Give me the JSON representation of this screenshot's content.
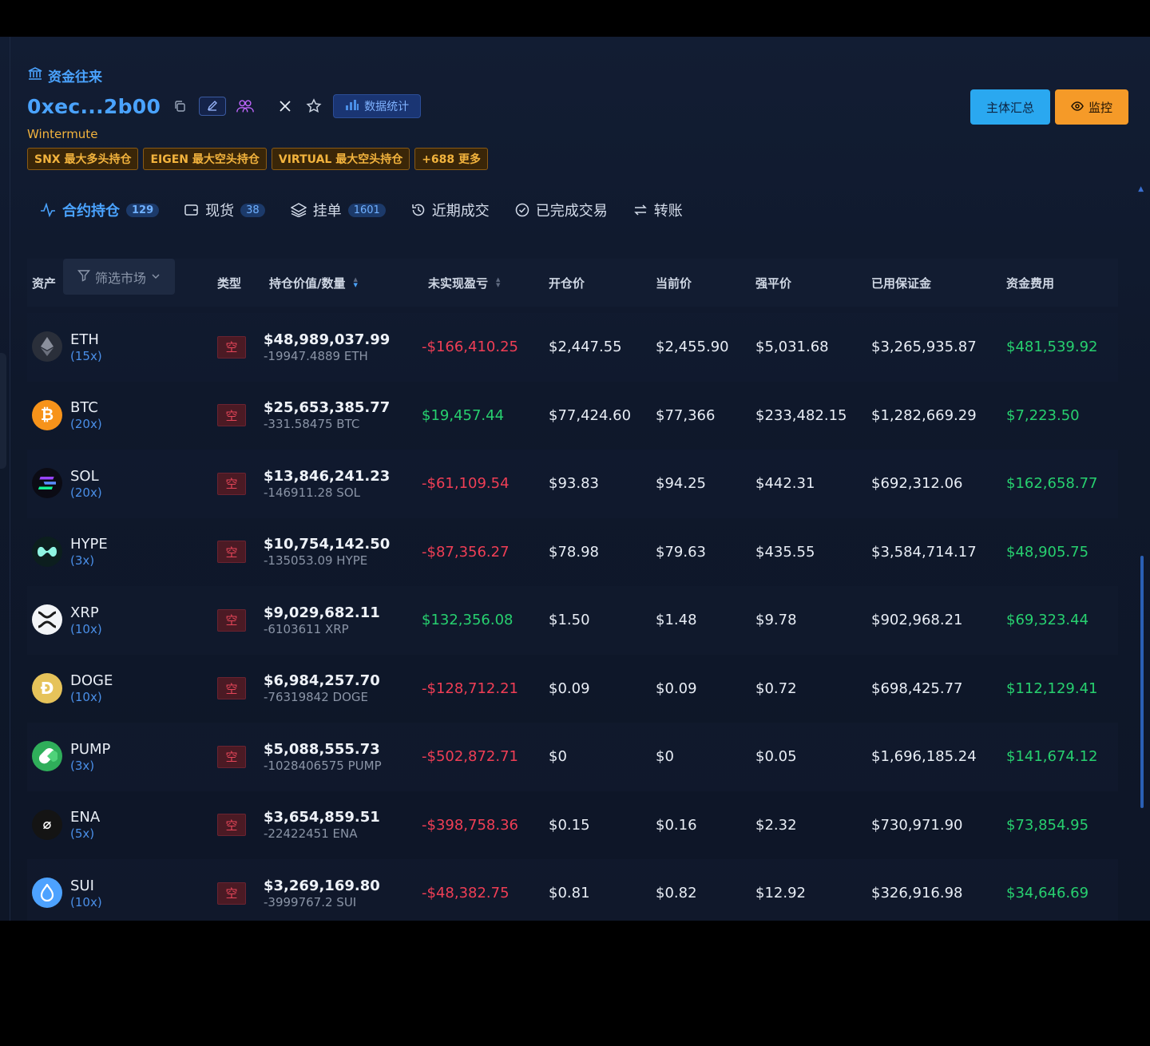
{
  "header": {
    "section_title": "资金往来",
    "address": "0xec...2b00",
    "stats_label": "数据统计",
    "entity": "Wintermute",
    "tags": [
      "SNX 最大多头持仓",
      "EIGEN 最大空头持仓",
      "VIRTUAL 最大空头持仓",
      "+688 更多"
    ],
    "summary_button": "主体汇总",
    "monitor_button": "监控"
  },
  "tabs": [
    {
      "label": "合约持仓",
      "count": "129",
      "icon": "pulse-icon"
    },
    {
      "label": "现货",
      "count": "38",
      "icon": "wallet-icon"
    },
    {
      "label": "挂单",
      "count": "1601",
      "icon": "layers-icon"
    },
    {
      "label": "近期成交",
      "icon": "history-icon"
    },
    {
      "label": "已完成交易",
      "icon": "check-circle-icon"
    },
    {
      "label": "转账",
      "icon": "transfer-icon"
    }
  ],
  "table": {
    "headers": {
      "asset": "资产",
      "filter": "筛选市场",
      "type": "类型",
      "position": "持仓价值/数量",
      "pnl": "未实现盈亏",
      "open": "开仓价",
      "current": "当前价",
      "liq": "强平价",
      "margin": "已用保证金",
      "funding": "资金费用"
    },
    "rows": [
      {
        "symbol": "ETH",
        "leverage": "(15x)",
        "type": "空",
        "value": "$48,989,037.99",
        "qty": "-19947.4889 ETH",
        "pnl": "-$166,410.25",
        "pnl_sign": "neg",
        "open": "$2,447.55",
        "current": "$2,455.90",
        "liq": "$5,031.68",
        "margin": "$3,265,935.87",
        "funding": "$481,539.92",
        "icon": "eth-icon",
        "color": "#2a2f3a"
      },
      {
        "symbol": "BTC",
        "leverage": "(20x)",
        "type": "空",
        "value": "$25,653,385.77",
        "qty": "-331.58475 BTC",
        "pnl": "$19,457.44",
        "pnl_sign": "pos",
        "open": "$77,424.60",
        "current": "$77,366",
        "liq": "$233,482.15",
        "margin": "$1,282,669.29",
        "funding": "$7,223.50",
        "icon": "btc-icon",
        "color": "#f7931a"
      },
      {
        "symbol": "SOL",
        "leverage": "(20x)",
        "type": "空",
        "value": "$13,846,241.23",
        "qty": "-146911.28 SOL",
        "pnl": "-$61,109.54",
        "pnl_sign": "neg",
        "open": "$93.83",
        "current": "$94.25",
        "liq": "$442.31",
        "margin": "$692,312.06",
        "funding": "$162,658.77",
        "icon": "sol-icon",
        "color": "#0b0b14"
      },
      {
        "symbol": "HYPE",
        "leverage": "(3x)",
        "type": "空",
        "value": "$10,754,142.50",
        "qty": "-135053.09 HYPE",
        "pnl": "-$87,356.27",
        "pnl_sign": "neg",
        "open": "$78.98",
        "current": "$79.63",
        "liq": "$435.55",
        "margin": "$3,584,714.17",
        "funding": "$48,905.75",
        "icon": "hype-icon",
        "color": "#0c1e1e"
      },
      {
        "symbol": "XRP",
        "leverage": "(10x)",
        "type": "空",
        "value": "$9,029,682.11",
        "qty": "-6103611 XRP",
        "pnl": "$132,356.08",
        "pnl_sign": "pos",
        "open": "$1.50",
        "current": "$1.48",
        "liq": "$9.78",
        "margin": "$902,968.21",
        "funding": "$69,323.44",
        "icon": "xrp-icon",
        "color": "#f2f4f7"
      },
      {
        "symbol": "DOGE",
        "leverage": "(10x)",
        "type": "空",
        "value": "$6,984,257.70",
        "qty": "-76319842 DOGE",
        "pnl": "-$128,712.21",
        "pnl_sign": "neg",
        "open": "$0.09",
        "current": "$0.09",
        "liq": "$0.72",
        "margin": "$698,425.77",
        "funding": "$112,129.41",
        "icon": "doge-icon",
        "color": "#e6c35a"
      },
      {
        "symbol": "PUMP",
        "leverage": "(3x)",
        "type": "空",
        "value": "$5,088,555.73",
        "qty": "-1028406575 PUMP",
        "pnl": "-$502,872.71",
        "pnl_sign": "neg",
        "open": "$0",
        "current": "$0",
        "liq": "$0.05",
        "margin": "$1,696,185.24",
        "funding": "$141,674.12",
        "icon": "pump-icon",
        "color": "#2fae5a"
      },
      {
        "symbol": "ENA",
        "leverage": "(5x)",
        "type": "空",
        "value": "$3,654,859.51",
        "qty": "-22422451 ENA",
        "pnl": "-$398,758.36",
        "pnl_sign": "neg",
        "open": "$0.15",
        "current": "$0.16",
        "liq": "$2.32",
        "margin": "$730,971.90",
        "funding": "$73,854.95",
        "icon": "ena-icon",
        "color": "#141414"
      },
      {
        "symbol": "SUI",
        "leverage": "(10x)",
        "type": "空",
        "value": "$3,269,169.80",
        "qty": "-3999767.2 SUI",
        "pnl": "-$48,382.75",
        "pnl_sign": "neg",
        "open": "$0.81",
        "current": "$0.82",
        "liq": "$12.92",
        "margin": "$326,916.98",
        "funding": "$34,646.69",
        "icon": "sui-icon",
        "color": "#4da2ff"
      }
    ]
  }
}
